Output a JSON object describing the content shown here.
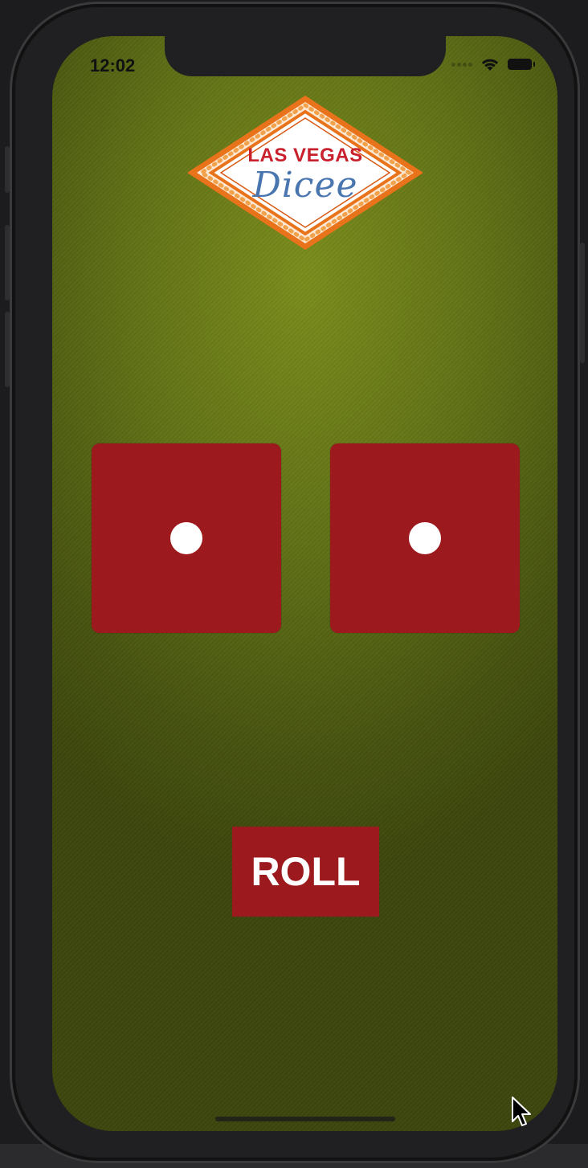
{
  "status_bar": {
    "time": "12:02",
    "icons": [
      "cellular-signal-icon",
      "wifi-icon",
      "battery-icon"
    ]
  },
  "logo": {
    "line1": "LAS VEGAS",
    "line2": "Dicee"
  },
  "dice": [
    {
      "name": "left-die",
      "face_value": 1
    },
    {
      "name": "right-die",
      "face_value": 1
    }
  ],
  "roll_button": {
    "label": "ROLL"
  },
  "colors": {
    "felt_center": "#7b8c1c",
    "felt_edge": "#3c460c",
    "dice_red": "#9c1a1e",
    "pip_white": "#ffffff",
    "logo_red": "#c8202c",
    "logo_blue": "#4a76b0",
    "marquee_orange": "#e8731a"
  }
}
